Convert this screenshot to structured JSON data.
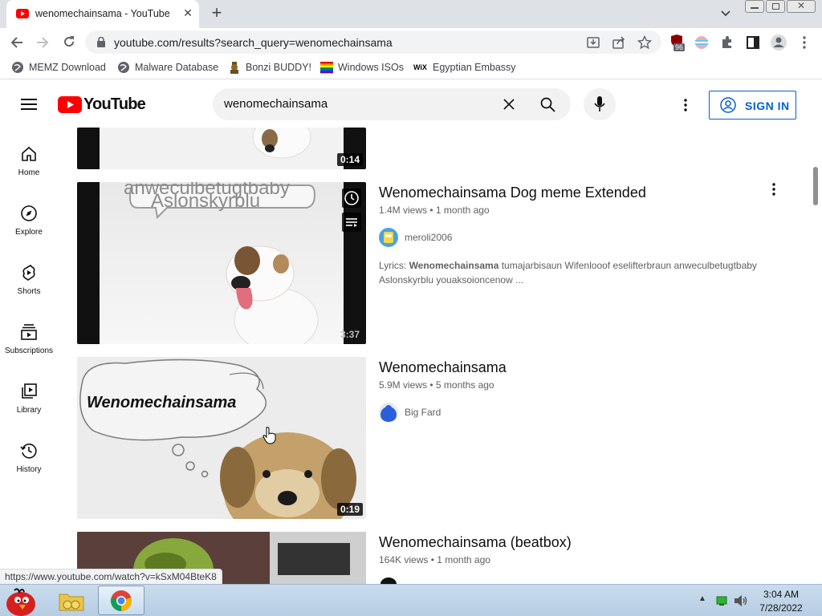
{
  "browser": {
    "tab_title": "wenomechainsama - YouTube",
    "url": "youtube.com/results?search_query=wenomechainsama",
    "extension_badge": "96",
    "bookmarks": [
      {
        "label": "MEMZ Download",
        "icon": "globe-icon"
      },
      {
        "label": "Malware Database",
        "icon": "globe-icon"
      },
      {
        "label": "Bonzi BUDDY!",
        "icon": "bonzi-icon"
      },
      {
        "label": "Windows ISOs",
        "icon": "windows-flag-icon"
      },
      {
        "label": "Egyptian Embassy",
        "icon": "wix-icon"
      }
    ],
    "status_url": "https://www.youtube.com/watch?v=kSxM04BteK8"
  },
  "youtube": {
    "logo_text": "YouTube",
    "search_value": "wenomechainsama",
    "sign_in_label": "SIGN IN",
    "sidebar": [
      {
        "label": "Home",
        "icon": "home-icon"
      },
      {
        "label": "Explore",
        "icon": "compass-icon"
      },
      {
        "label": "Shorts",
        "icon": "shorts-icon"
      },
      {
        "label": "Subscriptions",
        "icon": "subscriptions-icon"
      },
      {
        "label": "Library",
        "icon": "library-icon"
      },
      {
        "label": "History",
        "icon": "history-icon"
      }
    ],
    "results": [
      {
        "duration": "0:14"
      },
      {
        "title": "Wenomechainsama Dog meme Extended",
        "meta": "1.4M views • 1 month ago",
        "channel": "meroli2006",
        "duration": "3:37",
        "thumb_text_top": "anweculbetugtbaby",
        "thumb_text": "Aslonskyrblu",
        "desc_prefix": "Lyrics: ",
        "desc_bold": "Wenomechainsama",
        "desc_rest": " tumajarbisaun Wifenlooof eselifterbraun anweculbetugtbaby Aslonskyrblu youaksoioncenow ..."
      },
      {
        "title": "Wenomechainsama",
        "meta": "5.9M views • 5 months ago",
        "channel": "Big Fard",
        "duration": "0:19",
        "thumb_text": "Wenomechainsama"
      },
      {
        "title": "Wenomechainsama (beatbox)",
        "meta": "164K views • 1 month ago"
      }
    ]
  },
  "taskbar": {
    "time": "3:04 AM",
    "date": "7/28/2022"
  },
  "colors": {
    "youtube_red": "#ff0000",
    "sign_in_blue": "#065fd4",
    "taskbar": "#c9dced"
  }
}
